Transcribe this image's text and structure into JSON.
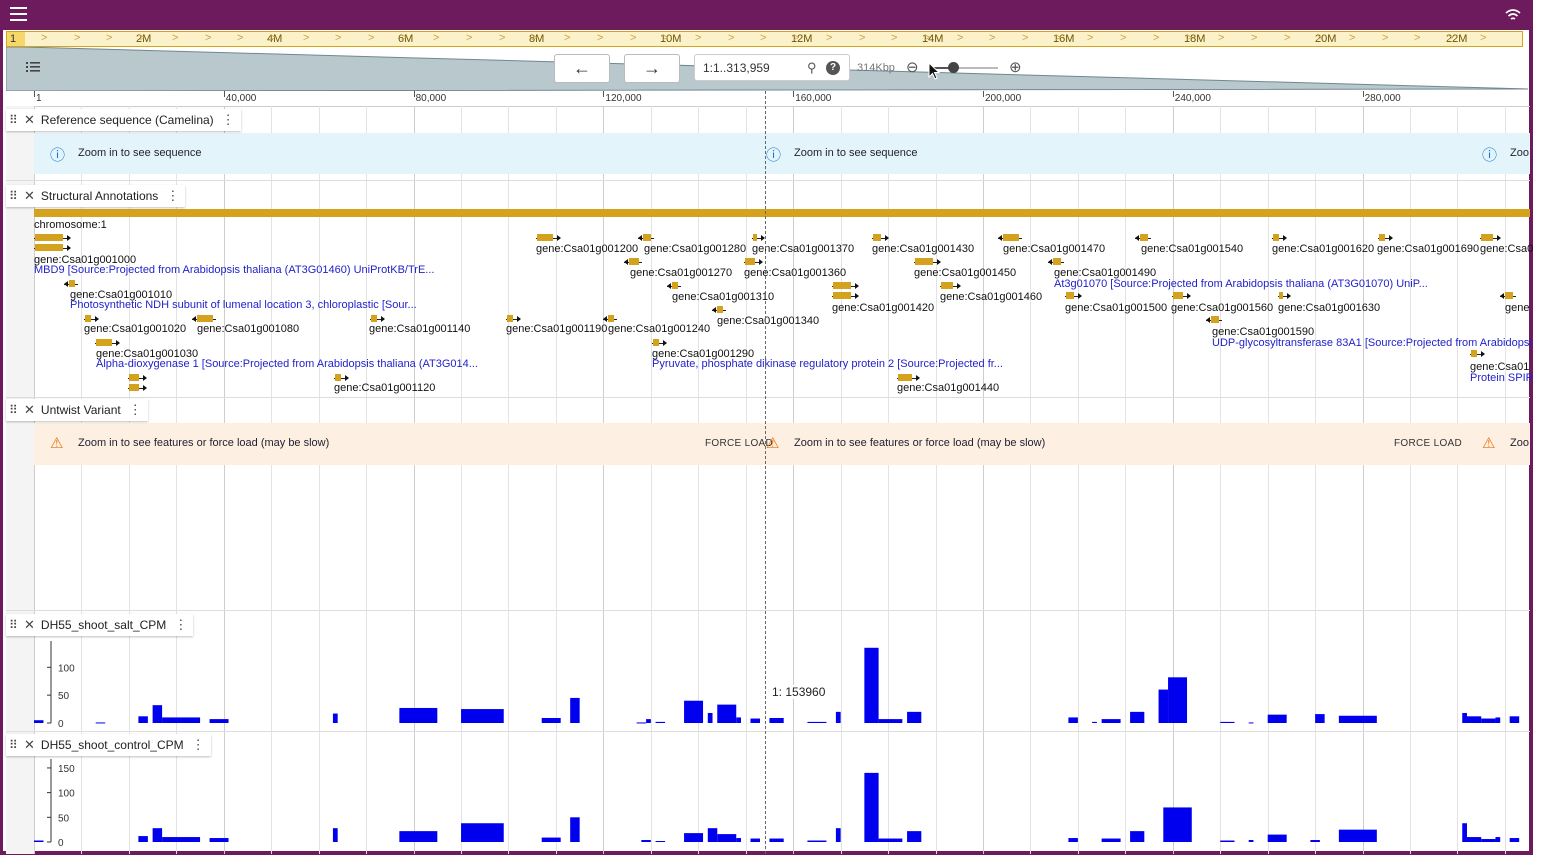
{
  "header": {
    "menu_icon": "hamburger-menu-icon",
    "connection_icon": "wifi-icon"
  },
  "overview": {
    "chromosome": "1",
    "labels": [
      "2M",
      "4M",
      "6M",
      "8M",
      "10M",
      "12M",
      "14M",
      "16M",
      "18M",
      "20M",
      "22M"
    ]
  },
  "navigation": {
    "back_icon": "arrow-left-icon",
    "forward_icon": "arrow-right-icon",
    "back_label": "←",
    "forward_label": "→",
    "location_value": "1:1..313,959",
    "search_icon": "search-icon",
    "help_label": "?",
    "bp_label": "314Kbp",
    "zoom_out_label": "⊖",
    "zoom_in_label": "⊕",
    "zoom_level": 0.3
  },
  "ruler": {
    "labels": [
      "1",
      "40,000",
      "80,000",
      "120,000",
      "160,000",
      "200,000",
      "240,000",
      "280,000"
    ]
  },
  "tracks": {
    "reference": {
      "name": "Reference sequence (Camelina)",
      "message": "Zoom in to see sequence",
      "message_clip": "Zoo"
    },
    "structural": {
      "name": "Structural Annotations",
      "chromosome_label": "chromosome:1",
      "genes": [
        "gene:Csa01g001000",
        "gene:Csa01g001010",
        "gene:Csa01g001020",
        "gene:Csa01g001080",
        "gene:Csa01g001030",
        "gene:Csa01g001140",
        "gene:Csa01g001120",
        "gene:Csa01g001190",
        "gene:Csa01g001200",
        "gene:Csa01g001240",
        "gene:Csa01g001280",
        "gene:Csa01g001270",
        "gene:Csa01g001310",
        "gene:Csa01g001290",
        "gene:Csa01g001340",
        "gene:Csa01g001370",
        "gene:Csa01g001360",
        "gene:Csa01g001430",
        "gene:Csa01g001420",
        "gene:Csa01g001450",
        "gene:Csa01g001460",
        "gene:Csa01g001440",
        "gene:Csa01g001470",
        "gene:Csa01g001490",
        "gene:Csa01g001500",
        "gene:Csa01g001540",
        "gene:Csa01g001560",
        "gene:Csa01g001590",
        "gene:Csa01g001620",
        "gene:Csa01g001630",
        "gene:Csa01g001690",
        "gene:Csa0",
        "gene",
        "gene:Csa01"
      ],
      "descriptions": [
        "MBD9 [Source:Projected from Arabidopsis thaliana (AT3G01460) UniProtKB/TrE...",
        "Photosynthetic NDH subunit of lumenal location 3, chloroplastic [Sour...",
        "Alpha-dioxygenase 1 [Source:Projected from Arabidopsis thaliana (AT3G014...",
        "Pyruvate, phosphate dikinase regulatory protein 2 [Source:Projected fr...",
        "At3g01070 [Source:Projected from Arabidopsis thaliana (AT3G01070) UniP...",
        "UDP-glycosyltransferase 83A1 [Source:Projected from Arabidopsi",
        "Protein SPIR"
      ]
    },
    "variant": {
      "name": "Untwist Variant",
      "message": "Zoom in to see features or force load (may be slow)",
      "force_label": "FORCE LOAD",
      "message_clip": "Zoo"
    },
    "salt": {
      "name": "DH55_shoot_salt_CPM",
      "yticks": [
        "100",
        "50",
        "0"
      ]
    },
    "control": {
      "name": "DH55_shoot_control_CPM",
      "yticks": [
        "150",
        "100",
        "50",
        "0"
      ]
    }
  },
  "coordinate_readout": "1: 153960",
  "chart_data": [
    {
      "type": "bar",
      "title": "DH55_shoot_salt_CPM",
      "ylim": [
        0,
        140
      ],
      "x_unit": "bp",
      "bins": [
        [
          1,
          2000,
          5
        ],
        [
          13000,
          15000,
          1
        ],
        [
          22000,
          24000,
          12
        ],
        [
          25000,
          27000,
          32
        ],
        [
          27000,
          35000,
          10
        ],
        [
          37000,
          41000,
          7
        ],
        [
          63000,
          64000,
          17
        ],
        [
          77000,
          85000,
          27
        ],
        [
          90000,
          99000,
          25
        ],
        [
          107000,
          111000,
          9
        ],
        [
          113000,
          115000,
          45
        ],
        [
          127000,
          129000,
          1
        ],
        [
          129000,
          130000,
          7
        ],
        [
          131000,
          133000,
          2
        ],
        [
          137000,
          141000,
          40
        ],
        [
          142000,
          143000,
          18
        ],
        [
          144000,
          148000,
          33
        ],
        [
          148000,
          149000,
          10
        ],
        [
          151000,
          153000,
          8
        ],
        [
          155000,
          158000,
          9
        ],
        [
          163000,
          167000,
          2
        ],
        [
          169000,
          170000,
          20
        ],
        [
          175000,
          178000,
          135
        ],
        [
          178000,
          183000,
          7
        ],
        [
          184000,
          187000,
          20
        ],
        [
          218000,
          220000,
          10
        ],
        [
          223000,
          224000,
          2
        ],
        [
          225000,
          229000,
          7
        ],
        [
          231000,
          234000,
          20
        ],
        [
          237000,
          239000,
          60
        ],
        [
          239000,
          243000,
          82
        ],
        [
          250000,
          253000,
          2
        ],
        [
          256000,
          257000,
          1
        ],
        [
          260000,
          264000,
          15
        ],
        [
          270000,
          272000,
          16
        ],
        [
          275000,
          283000,
          13
        ],
        [
          301000,
          302000,
          18
        ],
        [
          302000,
          305000,
          12
        ],
        [
          305000,
          308000,
          8
        ],
        [
          308000,
          309000,
          10
        ],
        [
          311000,
          313000,
          12
        ]
      ]
    },
    {
      "type": "bar",
      "title": "DH55_shoot_control_CPM",
      "ylim": [
        0,
        160
      ],
      "x_unit": "bp",
      "bins": [
        [
          1,
          2000,
          3
        ],
        [
          22000,
          24000,
          12
        ],
        [
          25000,
          27000,
          28
        ],
        [
          27000,
          35000,
          10
        ],
        [
          37000,
          41000,
          8
        ],
        [
          63000,
          64000,
          28
        ],
        [
          77000,
          85000,
          22
        ],
        [
          90000,
          99000,
          38
        ],
        [
          107000,
          111000,
          9
        ],
        [
          113000,
          115000,
          50
        ],
        [
          128000,
          130000,
          4
        ],
        [
          131000,
          133000,
          2
        ],
        [
          137000,
          141000,
          18
        ],
        [
          142000,
          144000,
          28
        ],
        [
          144000,
          148000,
          16
        ],
        [
          148000,
          149000,
          8
        ],
        [
          151000,
          153000,
          7
        ],
        [
          155000,
          158000,
          7
        ],
        [
          163000,
          167000,
          3
        ],
        [
          169000,
          170000,
          28
        ],
        [
          175000,
          178000,
          140
        ],
        [
          178000,
          183000,
          7
        ],
        [
          184000,
          187000,
          22
        ],
        [
          218000,
          220000,
          8
        ],
        [
          225000,
          229000,
          7
        ],
        [
          231000,
          234000,
          22
        ],
        [
          238000,
          244000,
          70
        ],
        [
          250000,
          253000,
          3
        ],
        [
          256000,
          257000,
          4
        ],
        [
          260000,
          264000,
          15
        ],
        [
          269000,
          271000,
          4
        ],
        [
          275000,
          283000,
          25
        ],
        [
          301000,
          302000,
          38
        ],
        [
          302000,
          305000,
          10
        ],
        [
          305000,
          308000,
          6
        ],
        [
          308000,
          309000,
          10
        ],
        [
          311000,
          313000,
          8
        ]
      ]
    }
  ]
}
